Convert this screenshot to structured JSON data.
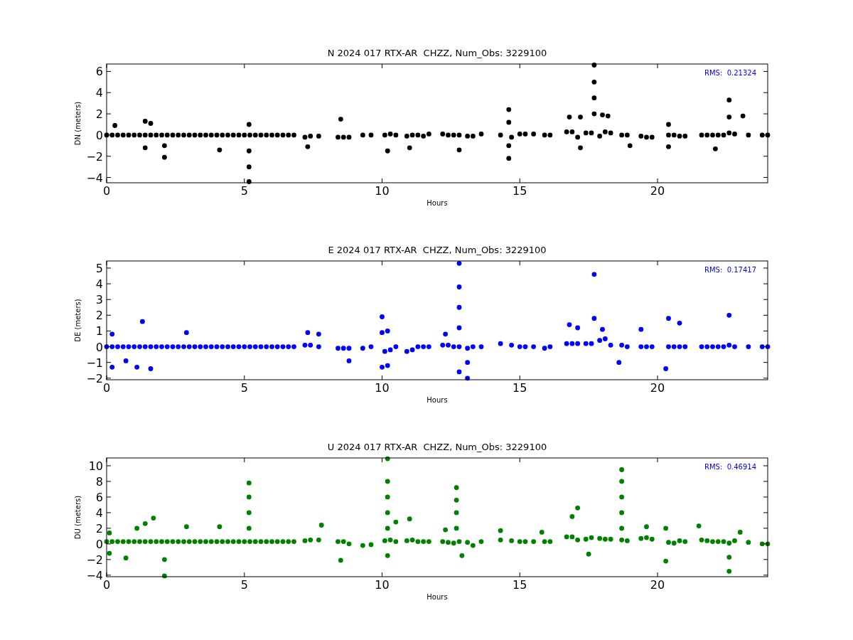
{
  "panels": [
    {
      "chart_data": {
        "type": "scatter",
        "title": "N 2024 017 RTX-AR  CHZZ, Num_Obs: 3229100",
        "xlabel": "Hours",
        "ylabel": "DN (meters)",
        "xlim": [
          0,
          24
        ],
        "ylim": [
          -4.5,
          6.7
        ],
        "xticks": [
          {
            "value": 0,
            "label": "0"
          },
          {
            "value": 5,
            "label": "5"
          },
          {
            "value": 10,
            "label": "10"
          },
          {
            "value": 15,
            "label": "15"
          },
          {
            "value": 20,
            "label": "20"
          }
        ],
        "yticks": [
          {
            "value": -4,
            "label": "−4"
          },
          {
            "value": -2,
            "label": "−2"
          },
          {
            "value": 0,
            "label": "0"
          },
          {
            "value": 2,
            "label": "2"
          },
          {
            "value": 4,
            "label": "4"
          },
          {
            "value": 6,
            "label": "6"
          }
        ],
        "annotations": [
          "RMS:  0.21324"
        ],
        "series": [
          {
            "color": "#000000",
            "x": [
              0,
              0.2,
              0.4,
              0.6,
              0.8,
              1,
              1.2,
              1.4,
              1.6,
              1.8,
              2,
              2.2,
              2.4,
              2.6,
              2.8,
              3,
              3.2,
              3.4,
              3.6,
              3.8,
              4,
              4.2,
              4.4,
              4.6,
              4.8,
              5,
              5.2,
              5.4,
              5.6,
              5.8,
              6,
              6.2,
              6.4,
              6.6,
              6.8,
              7.2,
              7.4,
              7.7,
              8.4,
              8.6,
              8.8,
              9.3,
              9.6,
              10.1,
              10.3,
              10.5,
              10.9,
              11.1,
              11.3,
              11.5,
              11.7,
              12.2,
              12.4,
              12.6,
              12.8,
              13.1,
              13.3,
              13.6,
              14.3,
              14.7,
              15,
              15.2,
              15.5,
              15.9,
              16.1,
              16.7,
              16.9,
              17.1,
              17.4,
              17.6,
              17.9,
              18.1,
              18.3,
              18.7,
              18.9,
              19.4,
              19.6,
              19.8,
              20.4,
              20.6,
              20.8,
              21,
              21.6,
              21.8,
              22,
              22.2,
              22.4,
              22.6,
              22.8,
              23.3,
              23.8,
              24,
              0.3,
              1.4,
              1.4,
              1.6,
              2.1,
              4.1,
              5.17,
              5.17,
              7.3,
              8.5,
              10.2,
              11,
              12.8,
              14.6,
              14.6,
              16.8,
              17.2,
              17.2,
              17.7,
              18,
              18.2,
              19,
              20.4,
              20.4,
              22.1,
              22.6,
              23.1,
              5.17,
              5.17,
              17.7,
              17.7,
              17.7,
              14.6,
              14.6,
              22.6,
              2.1
            ],
            "values": [
              0,
              0,
              0,
              0,
              0,
              0,
              0,
              0,
              0,
              0,
              0,
              0,
              0,
              0,
              0,
              0,
              0,
              0,
              0,
              0,
              0,
              0,
              0,
              0,
              0,
              0,
              0,
              0,
              0,
              0,
              0,
              0,
              0,
              0,
              0,
              -0.2,
              -0.1,
              -0.1,
              -0.2,
              -0.2,
              -0.2,
              0,
              0,
              0,
              0.1,
              0,
              -0.1,
              0,
              0,
              -0.1,
              0.1,
              0.1,
              0,
              0,
              0,
              -0.1,
              -0.1,
              0.1,
              0,
              -0.2,
              0.1,
              0.1,
              0.1,
              0,
              0,
              0.3,
              0.3,
              -0.2,
              0.2,
              0.2,
              -0.1,
              0.3,
              0.2,
              0,
              0,
              -0.1,
              -0.2,
              -0.2,
              0,
              0,
              -0.1,
              -0.1,
              0,
              0,
              0,
              0,
              0,
              0.2,
              0.1,
              0,
              0,
              0,
              0.9,
              -1.2,
              1.3,
              1.1,
              -2.1,
              -1.4,
              -4.4,
              1,
              -1.1,
              1.5,
              -1.5,
              -1.2,
              -1.4,
              -2.2,
              2.4,
              1.7,
              -1.2,
              1.7,
              6.6,
              1.9,
              1.8,
              -1,
              -1.1,
              1,
              -1.3,
              3.3,
              1.8,
              -1.5,
              -3,
              2,
              3.5,
              5,
              -1,
              1.2,
              1.7,
              -1
            ]
          }
        ]
      }
    },
    {
      "chart_data": {
        "type": "scatter",
        "title": "E 2024 017 RTX-AR  CHZZ, Num_Obs: 3229100",
        "xlabel": "Hours",
        "ylabel": "DE (meters)",
        "xlim": [
          0,
          24
        ],
        "ylim": [
          -2.1,
          5.45
        ],
        "xticks": [
          {
            "value": 0,
            "label": "0"
          },
          {
            "value": 5,
            "label": "5"
          },
          {
            "value": 10,
            "label": "10"
          },
          {
            "value": 15,
            "label": "15"
          },
          {
            "value": 20,
            "label": "20"
          }
        ],
        "yticks": [
          {
            "value": -2,
            "label": "−2"
          },
          {
            "value": -1,
            "label": "−1"
          },
          {
            "value": 0,
            "label": "0"
          },
          {
            "value": 1,
            "label": "1"
          },
          {
            "value": 2,
            "label": "2"
          },
          {
            "value": 3,
            "label": "3"
          },
          {
            "value": 4,
            "label": "4"
          },
          {
            "value": 5,
            "label": "5"
          }
        ],
        "annotations": [
          "RMS:  0.17417"
        ],
        "series": [
          {
            "color": "#0000ff",
            "x": [
              0,
              0.2,
              0.4,
              0.6,
              0.8,
              1,
              1.2,
              1.4,
              1.6,
              1.8,
              2,
              2.2,
              2.4,
              2.6,
              2.8,
              3,
              3.2,
              3.4,
              3.6,
              3.8,
              4,
              4.2,
              4.4,
              4.6,
              4.8,
              5,
              5.2,
              5.4,
              5.6,
              5.8,
              6,
              6.2,
              6.4,
              6.6,
              6.8,
              7.2,
              7.4,
              7.7,
              8.4,
              8.6,
              8.8,
              9.3,
              9.6,
              10.1,
              10.3,
              10.5,
              10.9,
              11.1,
              11.3,
              11.5,
              11.7,
              12.2,
              12.4,
              12.6,
              12.8,
              13.1,
              13.3,
              13.6,
              14.3,
              14.7,
              15,
              15.2,
              15.5,
              15.9,
              16.1,
              16.7,
              16.9,
              17.1,
              17.4,
              17.6,
              17.9,
              18.1,
              18.3,
              18.7,
              18.9,
              19.4,
              19.6,
              19.8,
              20.4,
              20.6,
              20.8,
              21,
              21.6,
              21.8,
              22,
              22.2,
              22.4,
              22.6,
              22.8,
              23.3,
              23.8,
              24,
              0.2,
              0.2,
              0.7,
              1.1,
              1.3,
              1.6,
              2.9,
              7.3,
              7.7,
              8.8,
              10,
              10,
              10.2,
              10.2,
              12.3,
              12.8,
              12.8,
              13.1,
              16.8,
              17.1,
              17.7,
              17.7,
              18,
              18.6,
              19.4,
              20.3,
              20.4,
              20.8,
              22.6,
              12.8,
              12.8,
              12.8,
              10,
              13.1
            ],
            "values": [
              0,
              0,
              0,
              0,
              0,
              0,
              0,
              0,
              0,
              0,
              0,
              0,
              0,
              0,
              0,
              0,
              0,
              0,
              0,
              0,
              0,
              0,
              0,
              0,
              0,
              0,
              0,
              0,
              0,
              0,
              0,
              0,
              0,
              0,
              0,
              0.1,
              0.1,
              0,
              -0.1,
              -0.1,
              -0.1,
              -0.1,
              0,
              -0.3,
              -0.2,
              0,
              -0.3,
              -0.2,
              0,
              0,
              0,
              0.1,
              0.1,
              0,
              0,
              -0.1,
              0,
              0,
              0.2,
              0.1,
              0,
              0,
              0,
              -0.1,
              0,
              0.2,
              0.2,
              0.2,
              0.2,
              0.2,
              0.4,
              0.5,
              0.1,
              0.1,
              0,
              0,
              0,
              0,
              0,
              0,
              0,
              0,
              0,
              0,
              0,
              0,
              0,
              0.1,
              0,
              0,
              0,
              0,
              -1.3,
              0.8,
              -0.9,
              -1.3,
              1.6,
              -1.4,
              0.9,
              0.9,
              0.8,
              -0.9,
              -1.3,
              1.9,
              -1.2,
              1,
              0.8,
              -1.6,
              5.3,
              -2,
              1.4,
              1.2,
              1.8,
              4.6,
              1.1,
              -1,
              1.1,
              -1.4,
              1.8,
              1.5,
              2,
              1.2,
              2.5,
              3.8,
              0.9,
              -1
            ]
          }
        ]
      }
    },
    {
      "chart_data": {
        "type": "scatter",
        "title": "U 2024 017 RTX-AR  CHZZ, Num_Obs: 3229100",
        "xlabel": "Hours",
        "ylabel": "DU (meters)",
        "xlim": [
          0,
          24
        ],
        "ylim": [
          -4.2,
          11
        ],
        "xticks": [
          {
            "value": 0,
            "label": "0"
          },
          {
            "value": 5,
            "label": "5"
          },
          {
            "value": 10,
            "label": "10"
          },
          {
            "value": 15,
            "label": "15"
          },
          {
            "value": 20,
            "label": "20"
          }
        ],
        "yticks": [
          {
            "value": -4,
            "label": "−4"
          },
          {
            "value": -2,
            "label": "−2"
          },
          {
            "value": 0,
            "label": "0"
          },
          {
            "value": 2,
            "label": "2"
          },
          {
            "value": 4,
            "label": "4"
          },
          {
            "value": 6,
            "label": "6"
          },
          {
            "value": 8,
            "label": "8"
          },
          {
            "value": 10,
            "label": "10"
          }
        ],
        "annotations": [
          "RMS:  0.46914"
        ],
        "series": [
          {
            "color": "#008000",
            "x": [
              0,
              0.2,
              0.4,
              0.6,
              0.8,
              1,
              1.2,
              1.4,
              1.6,
              1.8,
              2,
              2.2,
              2.4,
              2.6,
              2.8,
              3,
              3.2,
              3.4,
              3.6,
              3.8,
              4,
              4.2,
              4.4,
              4.6,
              4.8,
              5,
              5.2,
              5.4,
              5.6,
              5.8,
              6,
              6.2,
              6.4,
              6.6,
              6.8,
              7.2,
              7.4,
              7.7,
              8.4,
              8.6,
              8.8,
              9.3,
              9.6,
              10.1,
              10.3,
              10.5,
              10.9,
              11.1,
              11.3,
              11.5,
              11.7,
              12.2,
              12.4,
              12.6,
              12.8,
              13.1,
              13.3,
              13.6,
              14.3,
              14.7,
              15,
              15.2,
              15.5,
              15.9,
              16.1,
              16.7,
              16.9,
              17.1,
              17.4,
              17.6,
              17.9,
              18.1,
              18.3,
              18.7,
              18.9,
              19.4,
              19.6,
              19.8,
              20.4,
              20.6,
              20.8,
              21,
              21.6,
              21.8,
              22,
              22.2,
              22.4,
              22.6,
              22.8,
              23.3,
              23.8,
              24,
              0.1,
              0.1,
              0.7,
              1.1,
              1.4,
              1.7,
              2.1,
              2.9,
              4.1,
              5.17,
              7.8,
              8.5,
              10.2,
              10.2,
              10.5,
              11,
              12.3,
              12.7,
              12.9,
              14.3,
              15.8,
              16.9,
              17.1,
              17.5,
              18.7,
              19.6,
              20.3,
              20.3,
              21.5,
              22.6,
              23,
              5.17,
              5.17,
              5.17,
              10.2,
              10.2,
              10.2,
              10.2,
              12.7,
              12.7,
              12.7,
              18.7,
              18.7,
              18.7,
              18.7,
              2.1,
              22.6
            ],
            "values": [
              0.3,
              0.3,
              0.3,
              0.3,
              0.3,
              0.3,
              0.3,
              0.3,
              0.3,
              0.3,
              0.3,
              0.3,
              0.3,
              0.3,
              0.3,
              0.3,
              0.3,
              0.3,
              0.3,
              0.3,
              0.3,
              0.3,
              0.3,
              0.3,
              0.3,
              0.3,
              0.3,
              0.3,
              0.3,
              0.3,
              0.3,
              0.3,
              0.3,
              0.3,
              0.3,
              0.4,
              0.5,
              0.5,
              0.3,
              0.3,
              0,
              -0.2,
              -0.1,
              0.4,
              0.5,
              0.3,
              0.4,
              0.5,
              0.3,
              0.3,
              0.3,
              0.3,
              0.2,
              0.1,
              0.3,
              0.2,
              -0.2,
              0.3,
              0.5,
              0.4,
              0.3,
              0.3,
              0.3,
              0.3,
              0.3,
              0.9,
              0.9,
              0.5,
              0.6,
              0.8,
              0.7,
              0.6,
              0.6,
              0.5,
              0.4,
              0.7,
              0.8,
              0.6,
              0.2,
              0.1,
              0.4,
              0.3,
              0.5,
              0.4,
              0.3,
              0.3,
              0.3,
              0.1,
              0.4,
              0.2,
              0,
              0,
              -1.2,
              1.4,
              -1.8,
              2,
              2.6,
              3.3,
              -4.1,
              2.2,
              2.2,
              7.8,
              2.4,
              -2.1,
              -1.5,
              10.9,
              2.8,
              3.2,
              1.8,
              7.2,
              -1.5,
              1.7,
              1.5,
              3.5,
              4.6,
              -1.3,
              9.5,
              2.2,
              -2.2,
              2,
              2.3,
              -3.5,
              1.5,
              2,
              4,
              6,
              2,
              4,
              6,
              8,
              2,
              4,
              5.6,
              2,
              4,
              6,
              8,
              -2,
              -1.7
            ]
          }
        ]
      }
    }
  ]
}
